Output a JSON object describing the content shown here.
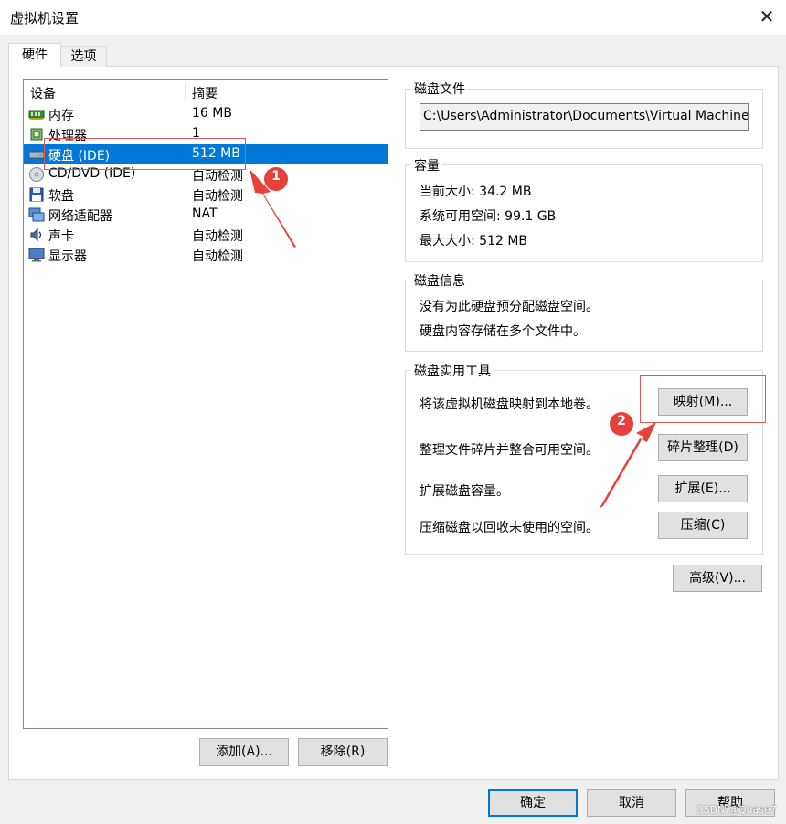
{
  "window": {
    "title": "虚拟机设置",
    "close_glyph": "✕"
  },
  "tabs": [
    {
      "label": "硬件"
    },
    {
      "label": "选项"
    }
  ],
  "device_list": {
    "columns": [
      "设备",
      "摘要"
    ],
    "rows": [
      {
        "name": "内存",
        "summary": "16 MB",
        "icon": "memory-icon"
      },
      {
        "name": "处理器",
        "summary": "1",
        "icon": "processor-icon"
      },
      {
        "name": "硬盘 (IDE)",
        "summary": "512 MB",
        "icon": "hard-disk-icon",
        "selected": true
      },
      {
        "name": "CD/DVD (IDE)",
        "summary": "自动检测",
        "icon": "cd-dvd-icon"
      },
      {
        "name": "软盘",
        "summary": "自动检测",
        "icon": "floppy-icon"
      },
      {
        "name": "网络适配器",
        "summary": "NAT",
        "icon": "network-adapter-icon"
      },
      {
        "name": "声卡",
        "summary": "自动检测",
        "icon": "sound-card-icon"
      },
      {
        "name": "显示器",
        "summary": "自动检测",
        "icon": "display-icon"
      }
    ]
  },
  "left_buttons": {
    "add": "添加(A)...",
    "remove": "移除(R)"
  },
  "disk_file": {
    "label": "磁盘文件",
    "path": "C:\\Users\\Administrator\\Documents\\Virtual Machines\\M"
  },
  "capacity": {
    "label": "容量",
    "current": "当前大小: 34.2 MB",
    "available": "系统可用空间: 99.1 GB",
    "max": "最大大小: 512 MB"
  },
  "disk_info": {
    "label": "磁盘信息",
    "line1": "没有为此硬盘预分配磁盘空间。",
    "line2": "硬盘内容存储在多个文件中。"
  },
  "disk_utils": {
    "label": "磁盘实用工具",
    "map_text": "将该虚拟机磁盘映射到本地卷。",
    "map_button": "映射(M)...",
    "defrag_text": "整理文件碎片并整合可用空间。",
    "defrag_button": "碎片整理(D)",
    "expand_text": "扩展磁盘容量。",
    "expand_button": "扩展(E)...",
    "compact_text": "压缩磁盘以回收未使用的空间。",
    "compact_button": "压缩(C)"
  },
  "advanced_button": "高级(V)...",
  "dialog_buttons": {
    "ok": "确定",
    "cancel": "取消",
    "help": "帮助"
  },
  "annotations": {
    "marker1": "1",
    "marker2": "2"
  },
  "watermark": "CSDN @Quase7",
  "colors": {
    "selection": "#0078d7",
    "annotation_red": "#e8403a"
  }
}
